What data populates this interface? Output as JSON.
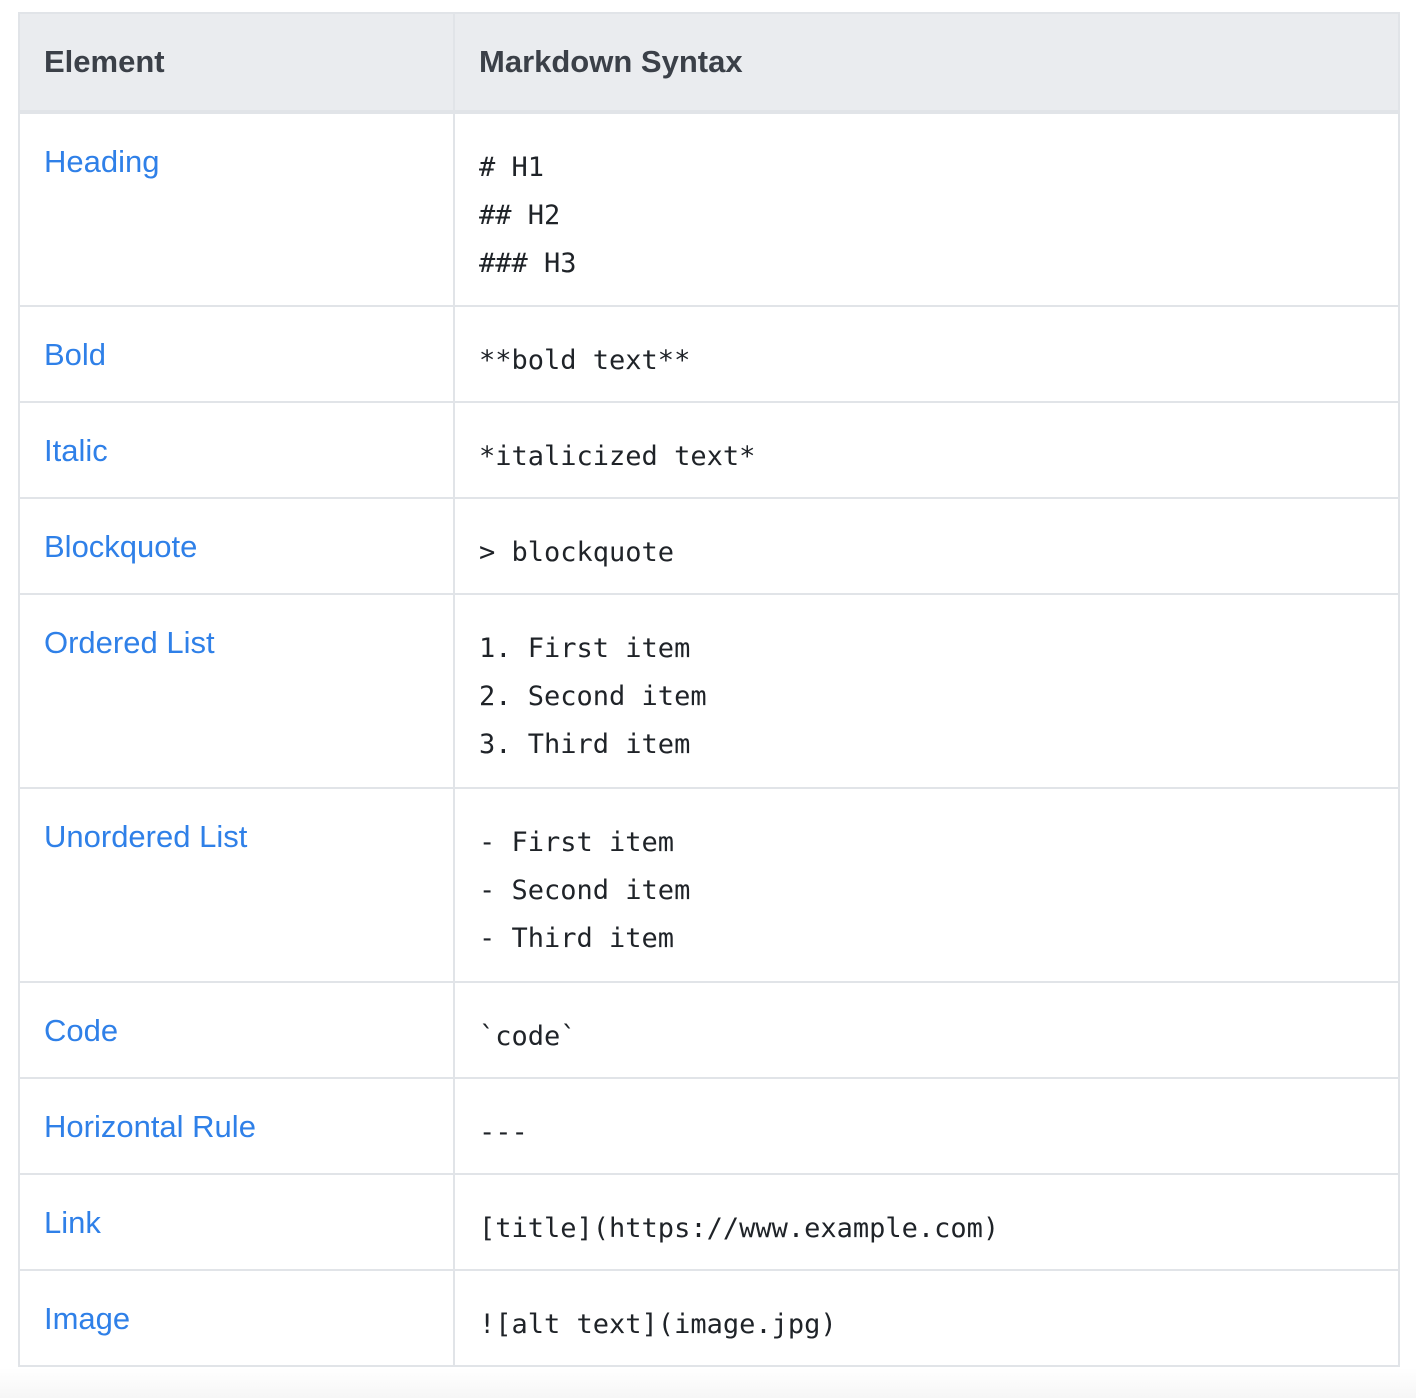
{
  "table": {
    "headers": [
      "Element",
      "Markdown Syntax"
    ],
    "rows": [
      {
        "element": "Heading",
        "syntax": [
          "# H1",
          "## H2",
          "### H3"
        ]
      },
      {
        "element": "Bold",
        "syntax": [
          "**bold text**"
        ]
      },
      {
        "element": "Italic",
        "syntax": [
          "*italicized text*"
        ]
      },
      {
        "element": "Blockquote",
        "syntax": [
          "> blockquote"
        ]
      },
      {
        "element": "Ordered List",
        "syntax": [
          "1. First item",
          "2. Second item",
          "3. Third item"
        ]
      },
      {
        "element": "Unordered List",
        "syntax": [
          "- First item",
          "- Second item",
          "- Third item"
        ]
      },
      {
        "element": "Code",
        "syntax": [
          "`code`"
        ]
      },
      {
        "element": "Horizontal Rule",
        "syntax": [
          "---"
        ]
      },
      {
        "element": "Link",
        "syntax": [
          "[title](https://www.example.com)"
        ]
      },
      {
        "element": "Image",
        "syntax": [
          "![alt text](image.jpg)"
        ]
      }
    ]
  },
  "colors": {
    "link": "#2f80e8",
    "header_bg": "#eaecef",
    "border": "#e1e4e8"
  }
}
